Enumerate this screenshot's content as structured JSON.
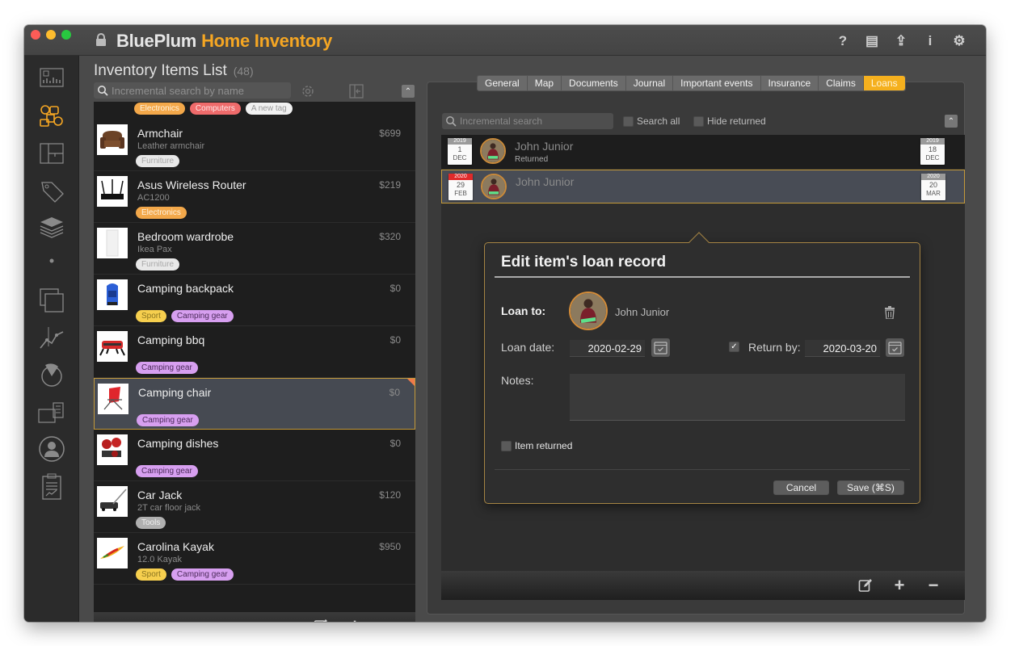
{
  "window": {
    "brand": "BluePlum",
    "product": "Home Inventory",
    "toolbar_icons": [
      "help-icon",
      "document-icon",
      "share-icon",
      "info-icon",
      "gear-icon"
    ],
    "toolbar_glyphs": [
      "?",
      "▤",
      "⇪",
      "i",
      "⚙"
    ]
  },
  "sidebar": {
    "items": [
      {
        "name": "dashboard",
        "active": false
      },
      {
        "name": "inventory-items",
        "active": true
      },
      {
        "name": "floor-plans",
        "active": false
      },
      {
        "name": "tags",
        "active": false
      },
      {
        "name": "categories",
        "active": false
      },
      {
        "name": "locations",
        "active": false
      },
      {
        "name": "collections",
        "active": false
      },
      {
        "name": "statistics",
        "active": false
      },
      {
        "name": "reports",
        "active": false
      },
      {
        "name": "insurance-claims",
        "active": false
      },
      {
        "name": "contacts",
        "active": false
      },
      {
        "name": "checklists",
        "active": false
      }
    ],
    "active_color": "#f5a623"
  },
  "inventory": {
    "title": "Inventory Items List",
    "count": "(48)",
    "search_placeholder": "Incremental search by name",
    "top_tags": [
      "Electronics",
      "Computers",
      "A new tag"
    ],
    "items": [
      {
        "name": "Armchair",
        "subtitle": "Leather armchair",
        "price": "$699",
        "tags": [
          {
            "label": "Furniture",
            "type": "furniture"
          }
        ]
      },
      {
        "name": "Asus Wireless Router",
        "subtitle": "AC1200",
        "price": "$219",
        "tags": [
          {
            "label": "Electronics",
            "type": "electronics"
          }
        ]
      },
      {
        "name": "Bedroom wardrobe",
        "subtitle": "Ikea Pax",
        "price": "$320",
        "tags": [
          {
            "label": "Furniture",
            "type": "furniture"
          }
        ]
      },
      {
        "name": "Camping backpack",
        "subtitle": "",
        "price": "$0",
        "tags": [
          {
            "label": "Sport",
            "type": "sport"
          },
          {
            "label": "Camping gear",
            "type": "camping"
          }
        ]
      },
      {
        "name": "Camping bbq",
        "subtitle": "",
        "price": "$0",
        "tags": [
          {
            "label": "Camping gear",
            "type": "camping"
          }
        ]
      },
      {
        "name": "Camping chair",
        "subtitle": "",
        "price": "$0",
        "selected": true,
        "tags": [
          {
            "label": "Camping gear",
            "type": "camping"
          }
        ]
      },
      {
        "name": "Camping dishes",
        "subtitle": "",
        "price": "$0",
        "tags": [
          {
            "label": "Camping gear",
            "type": "camping"
          }
        ]
      },
      {
        "name": "Car Jack",
        "subtitle": "2T car floor jack",
        "price": "$120",
        "tags": [
          {
            "label": "Tools",
            "type": "tools"
          }
        ]
      },
      {
        "name": "Carolina Kayak",
        "subtitle": "12.0 Kayak",
        "price": "$950",
        "tags": [
          {
            "label": "Sport",
            "type": "sport"
          },
          {
            "label": "Camping gear",
            "type": "camping"
          }
        ]
      }
    ],
    "footer": {
      "edit": "✎",
      "add": "+",
      "remove": "−"
    }
  },
  "details": {
    "tabs": [
      {
        "label": "General",
        "active": false
      },
      {
        "label": "Map",
        "active": false
      },
      {
        "label": "Documents",
        "active": false
      },
      {
        "label": "Journal",
        "active": false
      },
      {
        "label": "Important events",
        "active": false
      },
      {
        "label": "Insurance",
        "active": false
      },
      {
        "label": "Claims",
        "active": false
      },
      {
        "label": "Loans",
        "active": true
      }
    ],
    "search_placeholder": "Incremental search",
    "search_all_label": "Search all",
    "search_all_checked": false,
    "hide_returned_label": "Hide returned",
    "hide_returned_checked": false,
    "loans": [
      {
        "person": "John Junior",
        "status": "Returned",
        "loan_date": {
          "year": "2019",
          "day": "1",
          "month": "DEC"
        },
        "return_date": {
          "year": "2019",
          "day": "18",
          "month": "DEC"
        },
        "selected": false
      },
      {
        "person": "John Junior",
        "status": "",
        "loan_date": {
          "year": "2020",
          "day": "29",
          "month": "FEB"
        },
        "return_date": {
          "year": "2020",
          "day": "20",
          "month": "MAR"
        },
        "selected": true
      }
    ],
    "footer": {
      "edit": "✎",
      "add": "+",
      "remove": "−"
    }
  },
  "loan_editor": {
    "title": "Edit item's loan record",
    "loan_to_label": "Loan to:",
    "person": "John Junior",
    "loan_date_label": "Loan date:",
    "loan_date": "2020-02-29",
    "return_by_checked": true,
    "return_by_label": "Return by:",
    "return_by": "2020-03-20",
    "notes_label": "Notes:",
    "notes": "",
    "item_returned_label": "Item returned",
    "item_returned_checked": false,
    "cancel_label": "Cancel",
    "save_label": "Save  (⌘S)"
  }
}
